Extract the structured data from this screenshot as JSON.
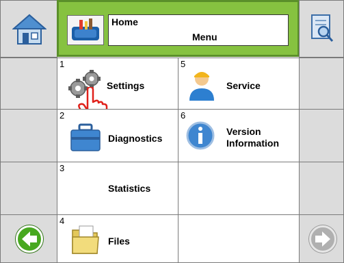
{
  "header": {
    "title": "Home",
    "subtitle": "Menu"
  },
  "menu": [
    {
      "num": "1",
      "label": "Settings",
      "icon": "gears-icon"
    },
    {
      "num": "2",
      "label": "Diagnostics",
      "icon": "toolbox-icon"
    },
    {
      "num": "3",
      "label": "Statistics",
      "icon": ""
    },
    {
      "num": "4",
      "label": "Files",
      "icon": "folder-icon"
    },
    {
      "num": "5",
      "label": "Service",
      "icon": "service-person-icon"
    },
    {
      "num": "6",
      "label": "Version Information",
      "label_line1": "Version",
      "label_line2": "Information",
      "icon": "info-icon"
    }
  ],
  "colors": {
    "header_green": "#86c240",
    "back_green": "#48a820",
    "grey": "#dcdcdc"
  }
}
